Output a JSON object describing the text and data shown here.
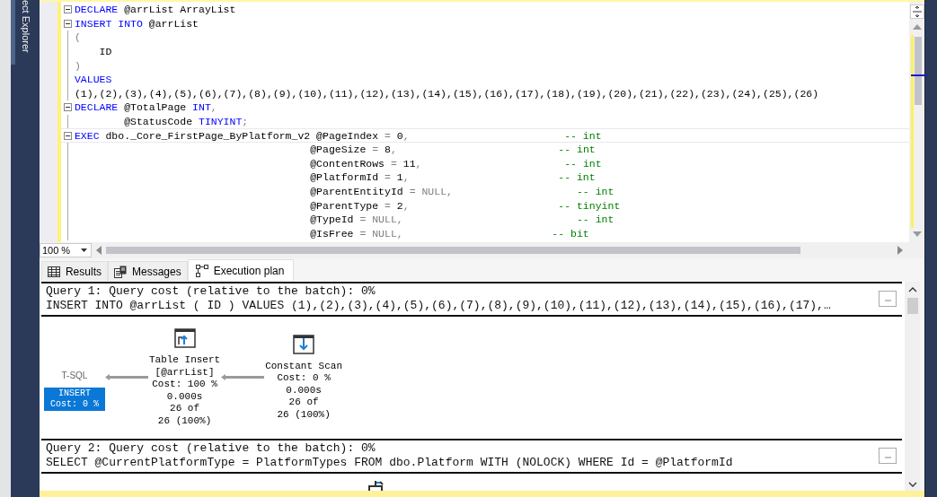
{
  "side_panel": {
    "title": "ect Explorer"
  },
  "editor": {
    "lines": [
      {
        "fold": true,
        "current": false,
        "tokens": [
          {
            "kind": "keyword",
            "text": "DECLARE"
          },
          {
            "kind": "plain",
            "text": " @arrList ArrayList"
          }
        ]
      },
      {
        "fold": true,
        "current": false,
        "tokens": [
          {
            "kind": "keyword",
            "text": "INSERT INTO"
          },
          {
            "kind": "plain",
            "text": " @arrList"
          }
        ]
      },
      {
        "fold": false,
        "current": false,
        "tokens": [
          {
            "kind": "punct",
            "text": "("
          }
        ]
      },
      {
        "fold": false,
        "current": false,
        "tokens": [
          {
            "kind": "plain",
            "text": "    ID"
          }
        ]
      },
      {
        "fold": false,
        "current": false,
        "tokens": [
          {
            "kind": "punct",
            "text": ")"
          }
        ]
      },
      {
        "fold": false,
        "current": false,
        "tokens": [
          {
            "kind": "keyword",
            "text": "VALUES"
          }
        ]
      },
      {
        "fold": false,
        "current": false,
        "tokens": [
          {
            "kind": "plain",
            "text": "(1),(2),(3),(4),(5),(6),(7),(8),(9),(10),(11),(12),(13),(14),(15),(16),(17),(18),(19),(20),(21),(22),(23),(24),(25),(26)"
          }
        ]
      },
      {
        "fold": true,
        "current": false,
        "tokens": [
          {
            "kind": "keyword",
            "text": "DECLARE"
          },
          {
            "kind": "plain",
            "text": " @TotalPage "
          },
          {
            "kind": "keyword",
            "text": "INT"
          },
          {
            "kind": "punct",
            "text": ","
          }
        ]
      },
      {
        "fold": false,
        "current": false,
        "tokens": [
          {
            "kind": "plain",
            "text": "        @StatusCode "
          },
          {
            "kind": "keyword",
            "text": "TINYINT"
          },
          {
            "kind": "punct",
            "text": ";"
          }
        ]
      },
      {
        "fold": true,
        "current": true,
        "tokens": [
          {
            "kind": "keyword",
            "text": "EXEC"
          },
          {
            "kind": "plain",
            "text": " dbo._Core_FirstPage_ByPlatform_v2 @PageIndex "
          },
          {
            "kind": "punct",
            "text": "="
          },
          {
            "kind": "plain",
            "text": " 0"
          },
          {
            "kind": "punct",
            "text": ","
          },
          {
            "kind": "comment",
            "text": "                         -- int"
          }
        ]
      },
      {
        "fold": false,
        "current": false,
        "tokens": [
          {
            "kind": "plain",
            "text": "                                      @PageSize "
          },
          {
            "kind": "punct",
            "text": "="
          },
          {
            "kind": "plain",
            "text": " 8"
          },
          {
            "kind": "punct",
            "text": ","
          },
          {
            "kind": "comment",
            "text": "                          -- int"
          }
        ]
      },
      {
        "fold": false,
        "current": false,
        "tokens": [
          {
            "kind": "plain",
            "text": "                                      @ContentRows "
          },
          {
            "kind": "punct",
            "text": "="
          },
          {
            "kind": "plain",
            "text": " 11"
          },
          {
            "kind": "punct",
            "text": ","
          },
          {
            "kind": "comment",
            "text": "                       -- int"
          }
        ]
      },
      {
        "fold": false,
        "current": false,
        "tokens": [
          {
            "kind": "plain",
            "text": "                                      @PlatformId "
          },
          {
            "kind": "punct",
            "text": "="
          },
          {
            "kind": "plain",
            "text": " 1"
          },
          {
            "kind": "punct",
            "text": ","
          },
          {
            "kind": "comment",
            "text": "                        -- int"
          }
        ]
      },
      {
        "fold": false,
        "current": false,
        "tokens": [
          {
            "kind": "plain",
            "text": "                                      @ParentEntityId "
          },
          {
            "kind": "punct",
            "text": "= NULL,"
          },
          {
            "kind": "comment",
            "text": "                    -- int"
          }
        ]
      },
      {
        "fold": false,
        "current": false,
        "tokens": [
          {
            "kind": "plain",
            "text": "                                      @ParentType "
          },
          {
            "kind": "punct",
            "text": "="
          },
          {
            "kind": "plain",
            "text": " 2"
          },
          {
            "kind": "punct",
            "text": ","
          },
          {
            "kind": "comment",
            "text": "                        -- tinyint"
          }
        ]
      },
      {
        "fold": false,
        "current": false,
        "tokens": [
          {
            "kind": "plain",
            "text": "                                      @TypeId "
          },
          {
            "kind": "punct",
            "text": "= NULL,"
          },
          {
            "kind": "comment",
            "text": "                            -- int"
          }
        ]
      },
      {
        "fold": false,
        "current": false,
        "tokens": [
          {
            "kind": "plain",
            "text": "                                      @IsFree "
          },
          {
            "kind": "punct",
            "text": "= NULL,"
          },
          {
            "kind": "comment",
            "text": "                        -- bit"
          }
        ]
      }
    ],
    "zoom": "100 %"
  },
  "results_tabs": [
    {
      "label": "Results",
      "selected": false
    },
    {
      "label": "Messages",
      "selected": false
    },
    {
      "label": "Execution plan",
      "selected": true
    }
  ],
  "plan": {
    "queries": [
      {
        "header": "Query 1: Query cost (relative to the batch): 0%",
        "statement": "INSERT INTO @arrList ( ID ) VALUES (1),(2),(3),(4),(5),(6),(7),(8),(9),(10),(11),(12),(13),(14),(15),(16),(17),…",
        "nodes": [
          {
            "kind": "root",
            "label": "T-SQL",
            "lines": [
              "INSERT",
              "Cost: 0 %"
            ],
            "selected": true
          },
          {
            "kind": "insert",
            "lines": [
              "Table Insert",
              "[@arrList]",
              "Cost: 100 %",
              "0.000s",
              "26 of",
              "26 (100%)"
            ],
            "selected": false
          },
          {
            "kind": "scan",
            "lines": [
              "Constant Scan",
              "Cost: 0 %",
              "0.000s",
              "26 of",
              "26 (100%)"
            ],
            "selected": false
          }
        ]
      },
      {
        "header": "Query 2: Query cost (relative to the batch): 0%",
        "statement": "SELECT @CurrentPlatformType = PlatformTypes FROM dbo.Platform WITH (NOLOCK) WHERE Id = @PlatformId",
        "nodes": [
          {
            "kind": "peek",
            "selected": false
          }
        ]
      }
    ]
  }
}
